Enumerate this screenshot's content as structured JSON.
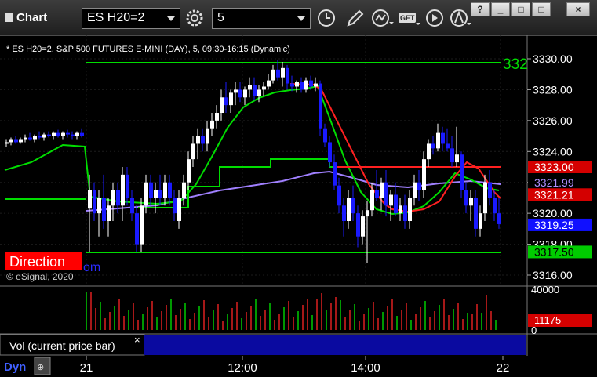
{
  "window": {
    "title": "Chart",
    "symbol": "ES H20=2",
    "interval": "5",
    "buttons": {
      "help": "?",
      "minimize": "_",
      "maximize": "□",
      "close": "×"
    }
  },
  "icons": [
    "interval-clock-icon",
    "pencil-icon",
    "study-icon",
    "get-icon",
    "play-icon",
    "cursor-icon",
    "gear-icon"
  ],
  "chart": {
    "header": "* ES H20=2, S&P 500 FUTURES E-MINI (DAY), 5, 09:30-16:15 (Dynamic)",
    "watermark": "© eSignal, 2020",
    "direction_label": "Direction",
    "partial_text": "om",
    "right_partial": "332",
    "colors": {
      "up": "#ffffff",
      "down": "#1a1aff",
      "green": "#00dd00",
      "red": "#ff2020",
      "purple": "#a080ff",
      "axis_text": "#ffffff"
    },
    "price_axis": {
      "ticks": [
        "3330.00",
        "3328.00",
        "3326.00",
        "3324.00",
        "3322.00",
        "3320.00",
        "3318.00",
        "3316.00"
      ],
      "labels": [
        {
          "text": "3323.00",
          "bg": "#d40000",
          "color": "#ffffff"
        },
        {
          "text": "3321.99",
          "bg": "#000000",
          "color": "#b090ff"
        },
        {
          "text": "3321.21",
          "bg": "#d40000",
          "color": "#ffffff"
        },
        {
          "text": "3319.25",
          "bg": "#1010ff",
          "color": "#ffffff"
        },
        {
          "text": "3317.50",
          "bg": "#00cc00",
          "color": "#000000"
        }
      ]
    },
    "volume_axis": {
      "tick": "40000",
      "zero": "0",
      "label": "11175",
      "label_bg": "#d40000"
    },
    "volume_panel_label": "Vol (current price bar)",
    "close_x": "×",
    "time_axis": {
      "left_label": "Dyn",
      "labels": [
        "21",
        "12:00",
        "14:00",
        "22"
      ]
    }
  }
}
